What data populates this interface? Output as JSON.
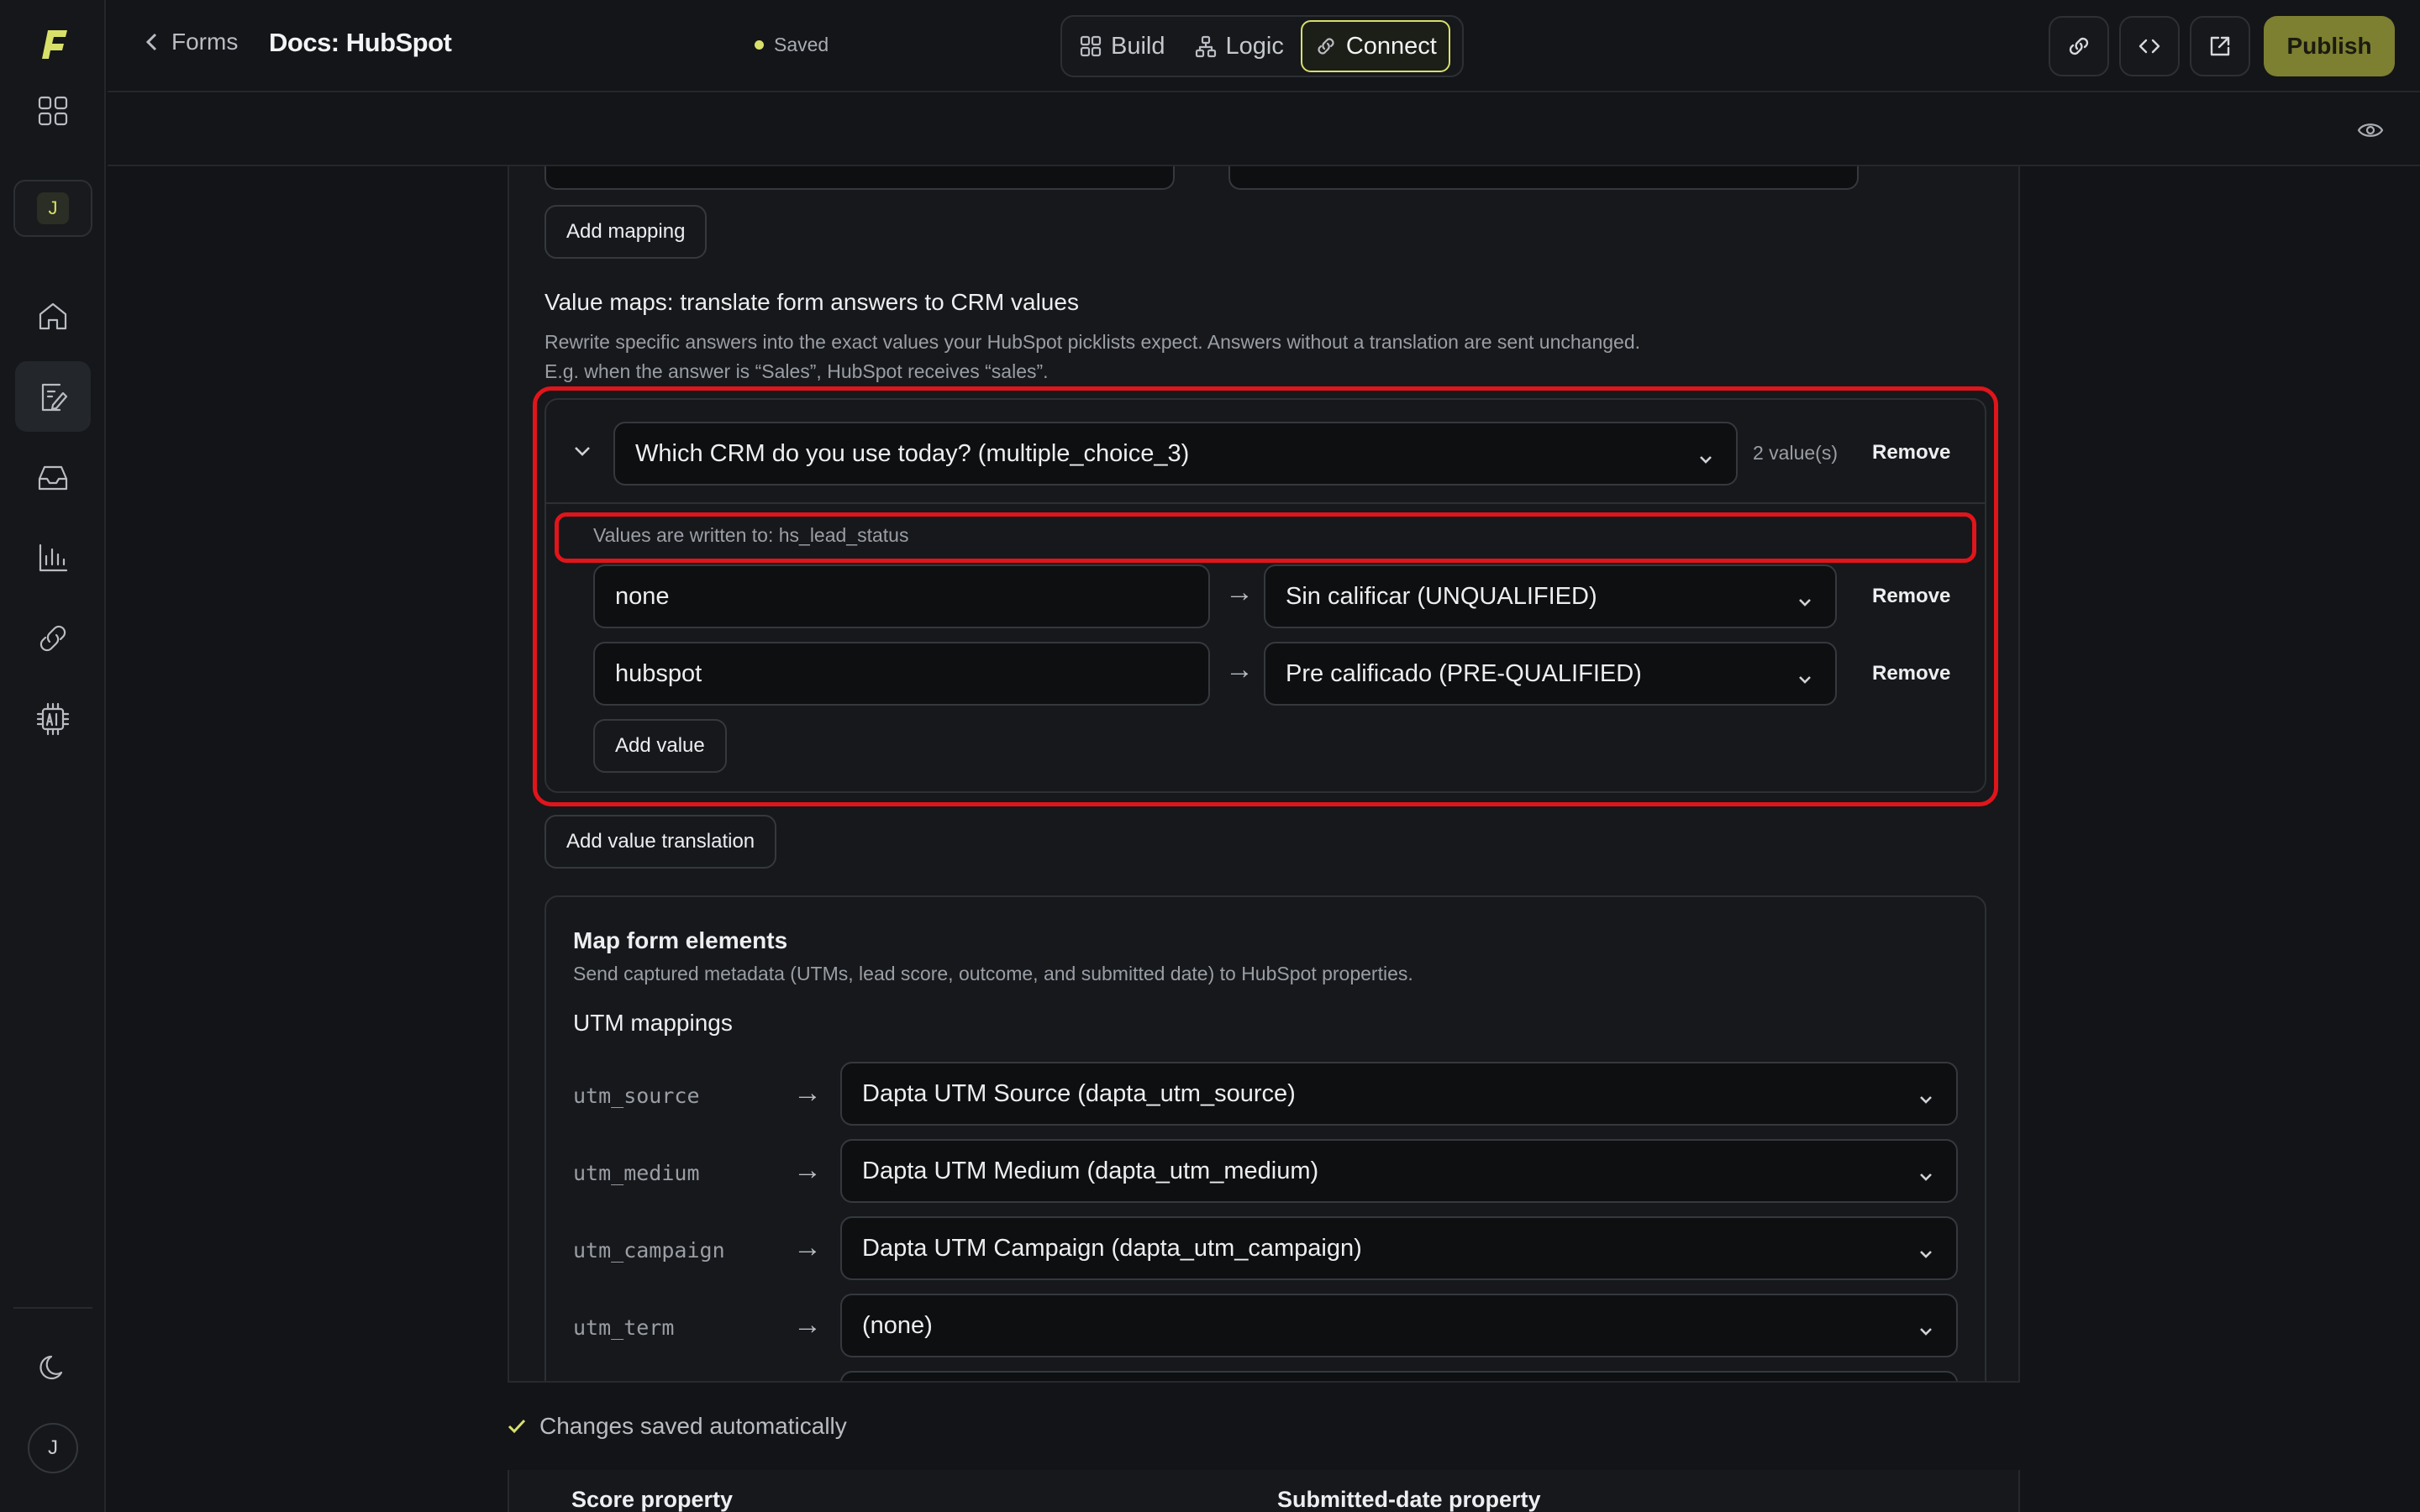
{
  "topbar": {
    "back_label": "Forms",
    "title": "Docs: HubSpot",
    "status": "Saved",
    "tabs": [
      {
        "label": "Build"
      },
      {
        "label": "Logic"
      },
      {
        "label": "Connect"
      }
    ],
    "publish_label": "Publish"
  },
  "sidebar": {
    "workspace_initial": "J",
    "user_initial": "J"
  },
  "mappings": {
    "add_mapping_label": "Add mapping"
  },
  "value_maps": {
    "heading": "Value maps: translate form answers to CRM values",
    "description": "Rewrite specific answers into the exact values your HubSpot picklists expect. Answers without a translation are sent unchanged.",
    "example": "E.g. when the answer is “Sales”, HubSpot receives “sales”.",
    "question": "Which CRM do you use today? (multiple_choice_3)",
    "value_count": "2 value(s)",
    "remove_label": "Remove",
    "written_to": "Values are written to: hs_lead_status",
    "rows": [
      {
        "answer": "none",
        "crm_value": "Sin calificar (UNQUALIFIED)",
        "remove": "Remove"
      },
      {
        "answer": "hubspot",
        "crm_value": "Pre calificado (PRE-QUALIFIED)",
        "remove": "Remove"
      }
    ],
    "add_value_label": "Add value",
    "add_translation_label": "Add value translation"
  },
  "map_form_elements": {
    "title": "Map form elements",
    "description": "Send captured metadata (UTMs, lead score, outcome, and submitted date) to HubSpot properties.",
    "utm_heading": "UTM mappings",
    "utm_rows": [
      {
        "key": "utm_source",
        "value": "Dapta UTM Source (dapta_utm_source)"
      },
      {
        "key": "utm_medium",
        "value": "Dapta UTM Medium (dapta_utm_medium)"
      },
      {
        "key": "utm_campaign",
        "value": "Dapta UTM Campaign (dapta_utm_campaign)"
      },
      {
        "key": "utm_term",
        "value": "(none)"
      }
    ],
    "arrow": "→"
  },
  "footer": {
    "autosave": "Changes saved automatically",
    "score_property": "Score property",
    "submitted_property": "Submitted-date property"
  },
  "colors": {
    "accent": "#d8e06a",
    "publish_bg": "#7d7f31",
    "highlight": "#e0151b"
  }
}
